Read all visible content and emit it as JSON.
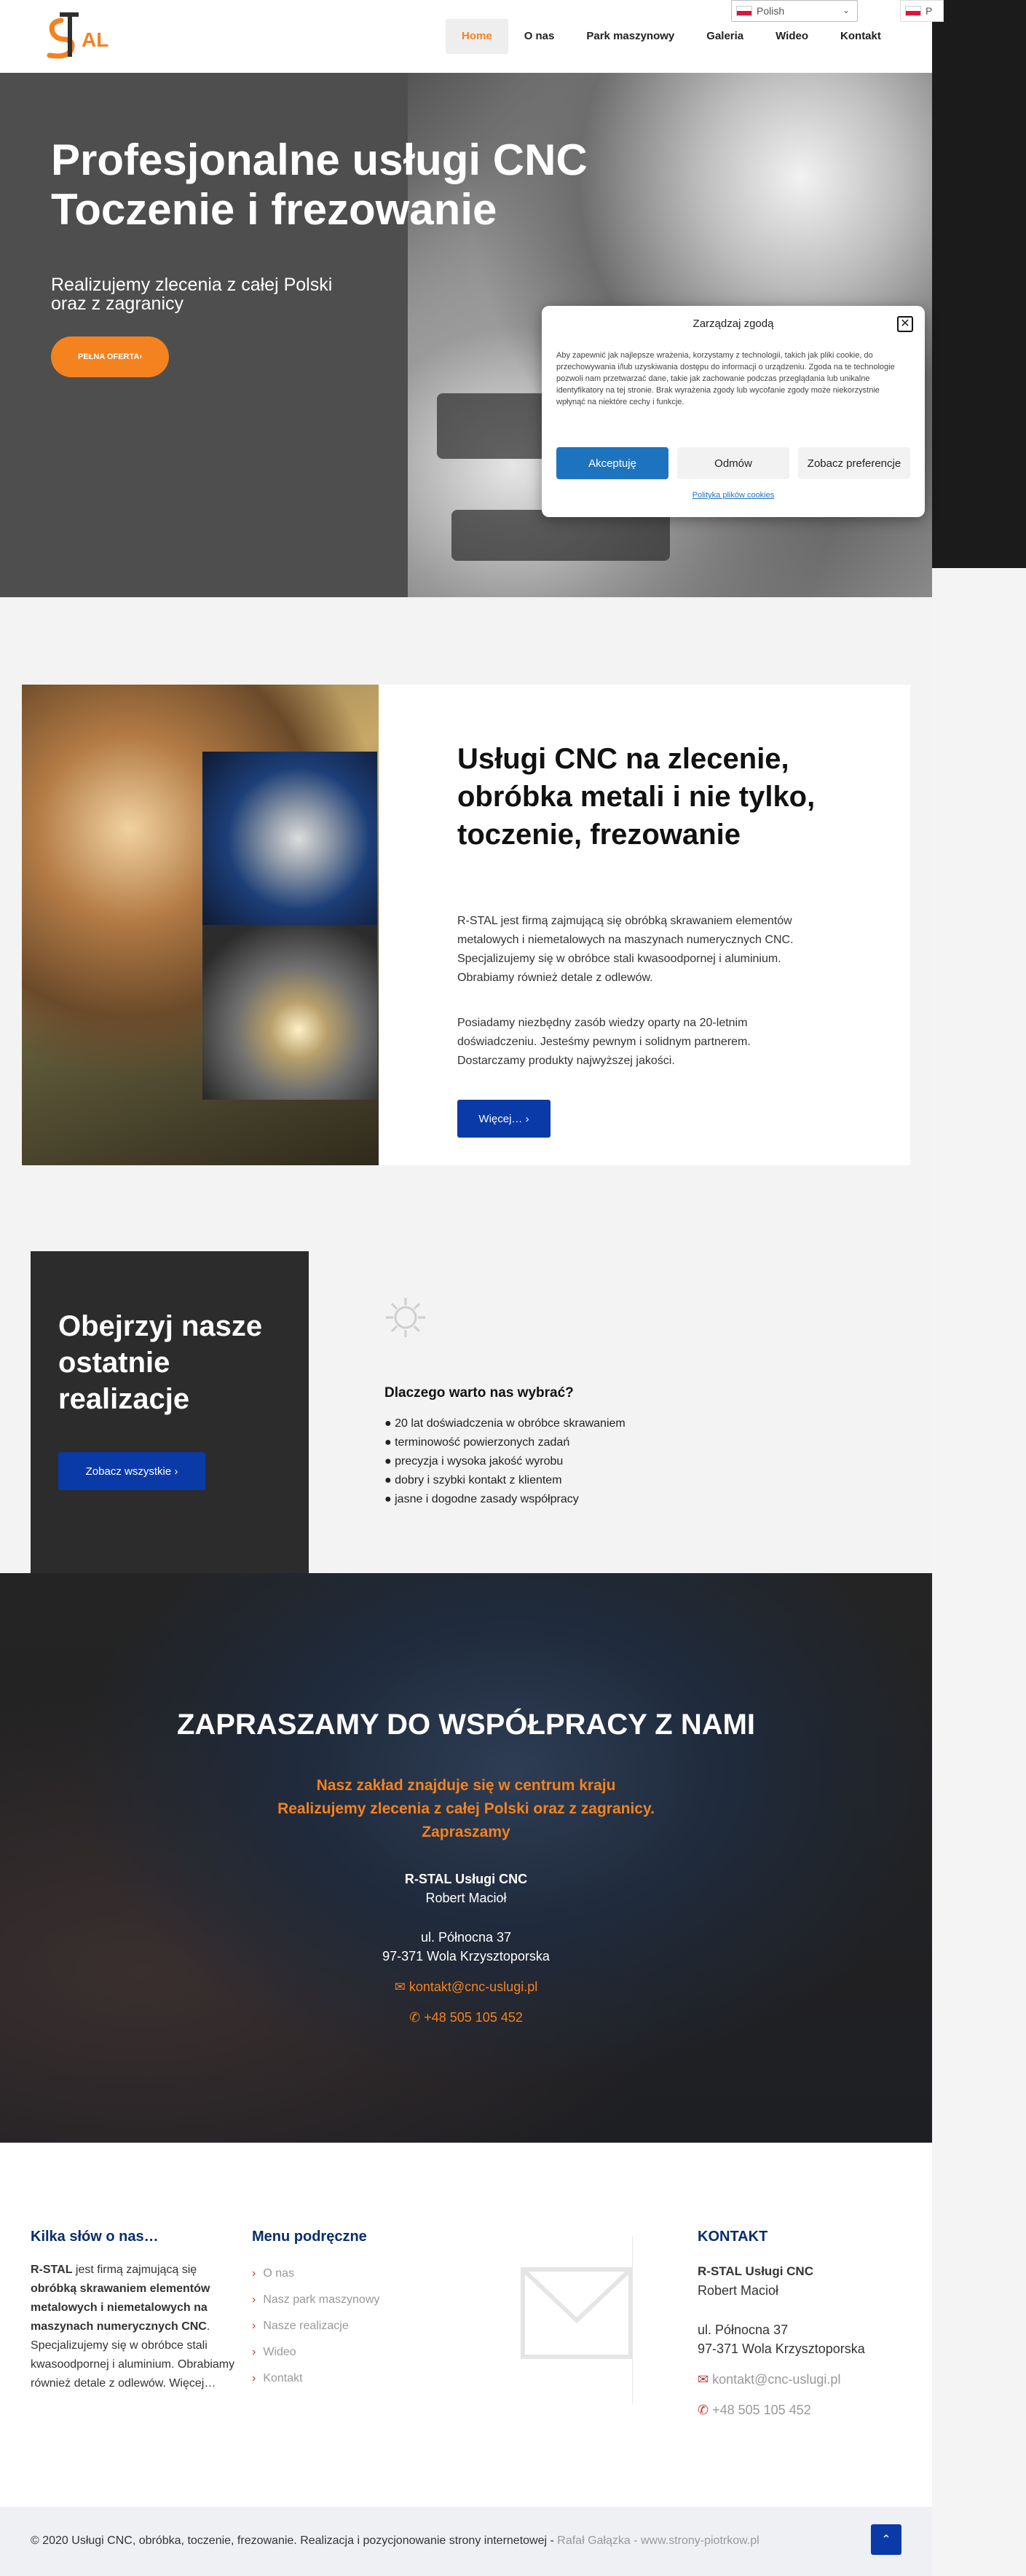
{
  "header": {
    "logo_text": "RSTAL",
    "nav": [
      "Home",
      "O nas",
      "Park maszynowy",
      "Galeria",
      "Wideo",
      "Kontakt"
    ],
    "language_select": "Polish",
    "language_mini": "P"
  },
  "hero": {
    "title": "Profesjonalne usługi CNC\nToczenie i frezowanie",
    "subtitle": "Realizujemy zlecenia z całej Polski\noraz z zagranicy",
    "button": "PEŁNA OFERTA›"
  },
  "cookie": {
    "title": "Zarządzaj zgodą",
    "close": "✕",
    "text": "Aby zapewnić jak najlepsze wrażenia, korzystamy z technologii, takich jak pliki cookie, do przechowywania i/lub uzyskiwania dostępu do informacji o urządzeniu. Zgoda na te technologie pozwoli nam przetwarzać dane, takie jak zachowanie podczas przeglądania lub unikalne identyfikatory na tej stronie. Brak wyrażenia zgody lub wycofanie zgody może niekorzystnie wpłynąć na niektóre cechy i funkcje.",
    "accept": "Akceptuję",
    "deny": "Odmów",
    "preferences": "Zobacz preferencje",
    "policy_link": "Polityka plików cookies"
  },
  "services": {
    "title": "Usługi CNC na zlecenie, obróbka metali i nie tylko, toczenie, frezowanie",
    "p1": "R-STAL jest firmą zajmującą się obróbką skrawaniem elementów metalowych i niemetalowych na maszynach numerycznych CNC. Specjalizujemy się w obróbce stali kwasoodpornej i aluminium. Obrabiamy również detale z odlewów.",
    "p2": "Posiadamy niezbędny zasób wiedzy oparty na 20-letnim doświadczeniu. Jesteśmy pewnym i solidnym partnerem. Dostarczamy produkty najwyższej jakości.",
    "button": "Więcej…  ›"
  },
  "realizations": {
    "title": "Obejrzyj nasze ostatnie realizacje",
    "button": "Zobacz wszystkie  ›",
    "why_title": "Dlaczego warto nas wybrać?",
    "why_list": [
      "● 20 lat doświadczenia w obróbce skrawaniem",
      "● terminowość powierzonych zadań",
      "● precyzja i wysoka jakość wyrobu",
      "● dobry i szybki kontakt z klientem",
      "● jasne i dogodne zasady współpracy"
    ]
  },
  "contact_banner": {
    "title": "ZAPRASZAMY DO WSPÓŁPRACY Z NAMI",
    "lead": "Nasz zakład znajduje się w centrum kraju\nRealizujemy zlecenia z całej Polski oraz z zagranicy.\nZapraszamy",
    "company": "R-STAL Usługi CNC",
    "person": "Robert Macioł",
    "street": "ul. Północna 37",
    "city": "97-371 Wola Krzysztoporska",
    "email": "✉ kontakt@cnc-uslugi.pl",
    "phone": "✆ +48 505 105 452"
  },
  "footer": {
    "about_title": "Kilka słów o nas…",
    "about_bold": "R-STAL",
    "about_mid": " jest firmą zajmującą się ",
    "about_bold2": "obróbką skrawaniem elementów metalowych i niemetalowych na maszynach numerycznych CNC",
    "about_rest": ". Specjalizujemy się w obróbce stali kwasoodpornej i aluminium. Obrabiamy również detale z odlewów. Więcej…",
    "menu_title": "Menu podręczne",
    "menu": [
      "O nas",
      "Nasz park maszynowy",
      "Nasze realizacje",
      "Wideo",
      "Kontakt"
    ],
    "contact_title": "KONTAKT",
    "company": "R-STAL Usługi CNC",
    "person": "Robert Macioł",
    "street": "ul. Północna 37",
    "city": "97-371 Wola Krzysztoporska",
    "email": "kontakt@cnc-uslugi.pl",
    "phone": "+48 505 105 452"
  },
  "bottom": {
    "copyright": "© 2020 Usługi CNC, obróbka, toczenie, frezowanie. Realizacja i pozycjonowanie strony internetowej - ",
    "credit": "Rafał Gałązka - www.strony-piotrkow.pl",
    "to_top": "⌃"
  },
  "colors": {
    "accent": "#f4821f",
    "primary_blue": "#0a3aa8",
    "cookie_blue": "#1e73be",
    "dark": "#2c2c2c"
  }
}
